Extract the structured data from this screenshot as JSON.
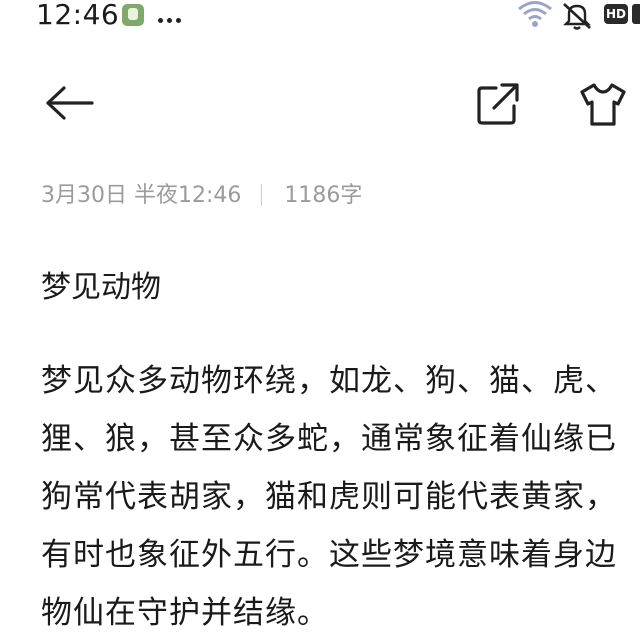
{
  "status_bar": {
    "time": "12:46",
    "hd_badge": "HD",
    "icons": [
      "app-notification-icon",
      "more-dots-icon",
      "wifi-icon",
      "mute-icon",
      "hd-icon",
      "battery-icon"
    ]
  },
  "toolbar": {
    "back_icon": "arrow-left-icon",
    "share_icon": "share-export-icon",
    "theme_icon": "shirt-theme-icon"
  },
  "meta": {
    "date": "3月30日 半夜12:46",
    "word_count": "1186字"
  },
  "note": {
    "title": "梦见动物",
    "lines": [
      "梦见众多动物环绕，如龙、狗、猫、虎、",
      "狸、狼，甚至众多蛇，通常象征着仙缘已",
      "狗常代表胡家，猫和虎则可能代表黄家，",
      "有时也象征外五行。这些梦境意味着身边",
      "物仙在守护并结缘。"
    ]
  }
}
